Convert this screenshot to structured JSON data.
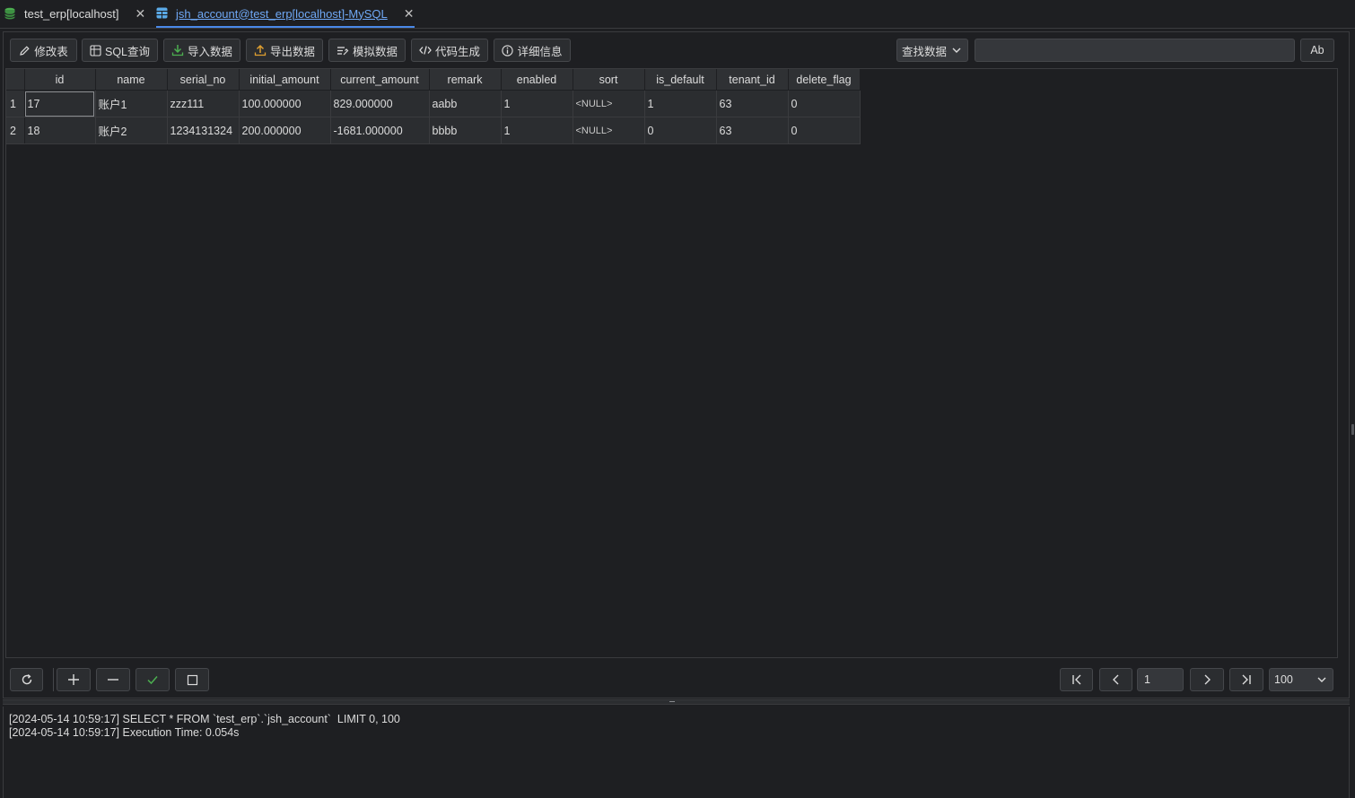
{
  "tabs": [
    {
      "label": "test_erp[localhost]",
      "icon": "database-icon",
      "active": false
    },
    {
      "label": "jsh_account@test_erp[localhost]-MySQL",
      "icon": "table-icon",
      "active": true
    }
  ],
  "toolbar": {
    "modify_table": "修改表",
    "sql_query": "SQL查询",
    "import_data": "导入数据",
    "export_data": "导出数据",
    "mock_data": "模拟数据",
    "code_gen": "代码生成",
    "details": "详细信息",
    "search_mode": "查找数据",
    "search_value": "",
    "case_sensitive": "Ab"
  },
  "grid": {
    "columns": [
      "id",
      "name",
      "serial_no",
      "initial_amount",
      "current_amount",
      "remark",
      "enabled",
      "sort",
      "is_default",
      "tenant_id",
      "delete_flag"
    ],
    "rows": [
      {
        "num": "1",
        "cells": [
          "17",
          "账户1",
          "zzz111",
          "100.000000",
          "829.000000",
          "aabb",
          "1",
          "<NULL>",
          "1",
          "63",
          "0"
        ]
      },
      {
        "num": "2",
        "cells": [
          "18",
          "账户2",
          "1234131324",
          "200.000000",
          "-1681.000000",
          "bbbb",
          "1",
          "<NULL>",
          "0",
          "63",
          "0"
        ]
      }
    ]
  },
  "pager": {
    "page": "1",
    "page_size": "100"
  },
  "log": [
    "[2024-05-14 10:59:17] SELECT * FROM `test_erp`.`jsh_account`  LIMIT 0, 100",
    "[2024-05-14 10:59:17] Execution Time: 0.054s"
  ],
  "colors": {
    "background": "#1e1f22",
    "active_tab": "#6fa8f5",
    "confirm_green": "#4caf50",
    "import_green": "#4caf50",
    "export_orange": "#e0a030"
  }
}
